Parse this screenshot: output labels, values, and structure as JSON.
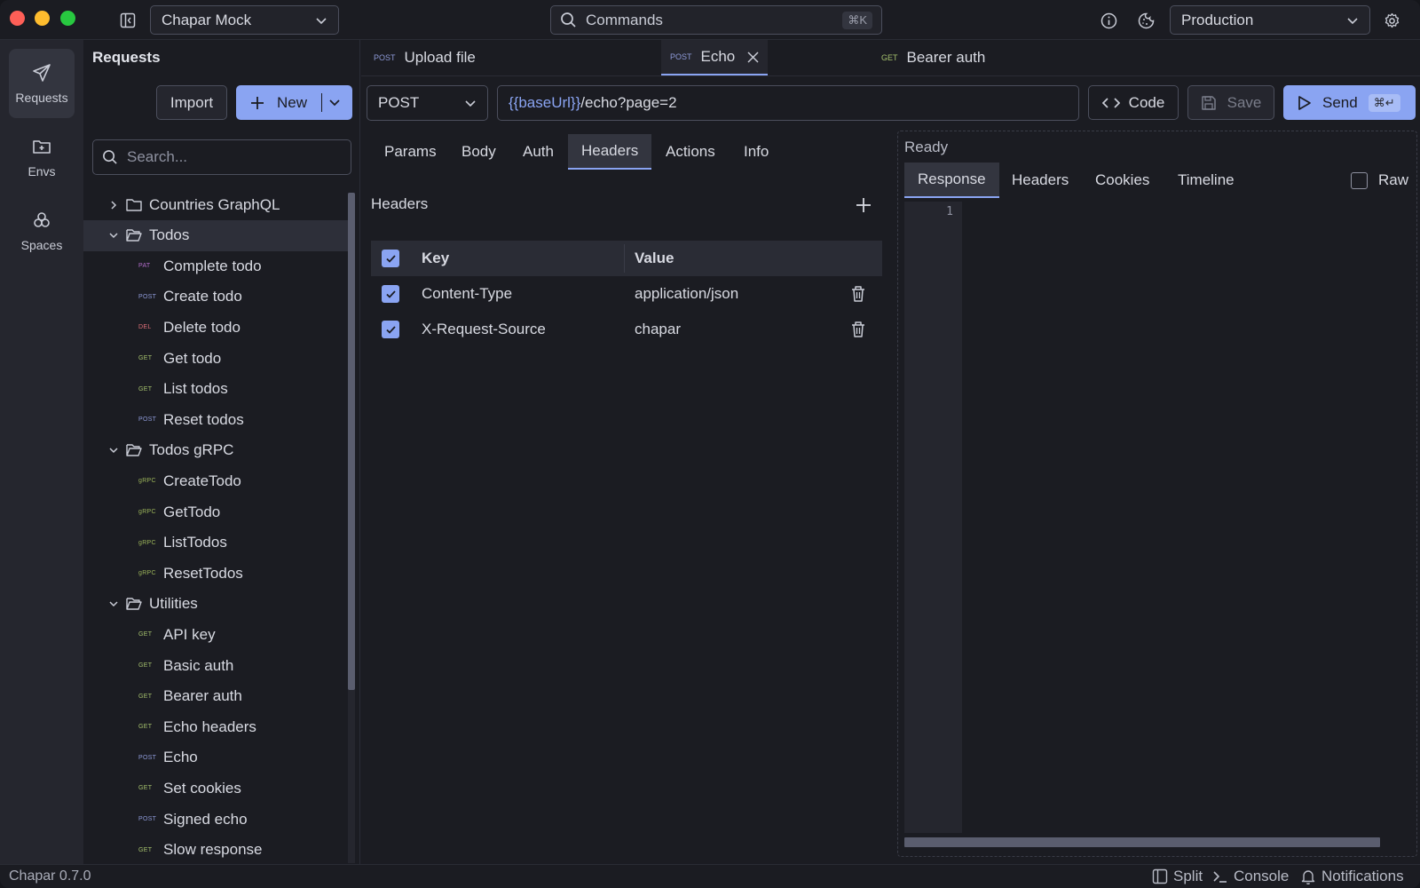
{
  "titlebar": {
    "workspace": "Chapar Mock",
    "command_placeholder": "Commands",
    "command_shortcut": "⌘K",
    "environment": "Production"
  },
  "rail": {
    "items": [
      {
        "label": "Requests",
        "icon": "send-icon"
      },
      {
        "label": "Envs",
        "icon": "folder-plus-icon"
      },
      {
        "label": "Spaces",
        "icon": "spaces-icon"
      }
    ]
  },
  "sidebar": {
    "title": "Requests",
    "import_label": "Import",
    "new_label": "New",
    "search_placeholder": "Search...",
    "tree": [
      {
        "type": "folder",
        "label": "Countries GraphQL",
        "expanded": false
      },
      {
        "type": "folder",
        "label": "Todos",
        "expanded": true,
        "selected": true
      },
      {
        "type": "request",
        "method": "PAT",
        "label": "Complete todo"
      },
      {
        "type": "request",
        "method": "POST",
        "label": "Create todo"
      },
      {
        "type": "request",
        "method": "DEL",
        "label": "Delete todo"
      },
      {
        "type": "request",
        "method": "GET",
        "label": "Get todo"
      },
      {
        "type": "request",
        "method": "GET",
        "label": "List todos"
      },
      {
        "type": "request",
        "method": "POST",
        "label": "Reset todos"
      },
      {
        "type": "folder",
        "label": "Todos gRPC",
        "expanded": true
      },
      {
        "type": "request",
        "method": "gRPC",
        "label": "CreateTodo"
      },
      {
        "type": "request",
        "method": "gRPC",
        "label": "GetTodo"
      },
      {
        "type": "request",
        "method": "gRPC",
        "label": "ListTodos"
      },
      {
        "type": "request",
        "method": "gRPC",
        "label": "ResetTodos"
      },
      {
        "type": "folder",
        "label": "Utilities",
        "expanded": true
      },
      {
        "type": "request",
        "method": "GET",
        "label": "API key"
      },
      {
        "type": "request",
        "method": "GET",
        "label": "Basic auth"
      },
      {
        "type": "request",
        "method": "GET",
        "label": "Bearer auth"
      },
      {
        "type": "request",
        "method": "GET",
        "label": "Echo headers"
      },
      {
        "type": "request",
        "method": "POST",
        "label": "Echo"
      },
      {
        "type": "request",
        "method": "GET",
        "label": "Set cookies"
      },
      {
        "type": "request",
        "method": "POST",
        "label": "Signed echo"
      },
      {
        "type": "request",
        "method": "GET",
        "label": "Slow response"
      }
    ]
  },
  "tabs": [
    {
      "method": "POST",
      "label": "Upload file"
    },
    {
      "method": "GET",
      "label": "Bearer auth"
    },
    {
      "method": "POST",
      "label": "Echo",
      "active": true
    }
  ],
  "request": {
    "method": "POST",
    "url_var": "{{baseUrl}}",
    "url_path": "/echo?page=2",
    "code_label": "Code",
    "save_label": "Save",
    "send_label": "Send",
    "send_shortcut": "⌘↵",
    "subtabs": [
      "Params",
      "Body",
      "Auth",
      "Headers",
      "Actions",
      "Info"
    ],
    "active_subtab": "Headers"
  },
  "headers_section": {
    "title": "Headers",
    "col_key": "Key",
    "col_value": "Value",
    "rows": [
      {
        "key": "Content-Type",
        "value": "application/json",
        "enabled": true
      },
      {
        "key": "X-Request-Source",
        "value": "chapar",
        "enabled": true
      }
    ]
  },
  "response": {
    "status": "Ready",
    "tabs": [
      "Response",
      "Headers",
      "Cookies",
      "Timeline"
    ],
    "active_tab": "Response",
    "raw_label": "Raw",
    "line_number": "1"
  },
  "statusbar": {
    "version": "Chapar 0.7.0",
    "split_label": "Split",
    "console_label": "Console",
    "notifications_label": "Notifications"
  },
  "colors": {
    "accent": "#8aa4f2",
    "method_get": "#a6c26e",
    "method_post": "#8e9ad8",
    "method_del": "#e0707a",
    "method_pat": "#b06bc9",
    "method_grpc": "#9bb45a"
  }
}
